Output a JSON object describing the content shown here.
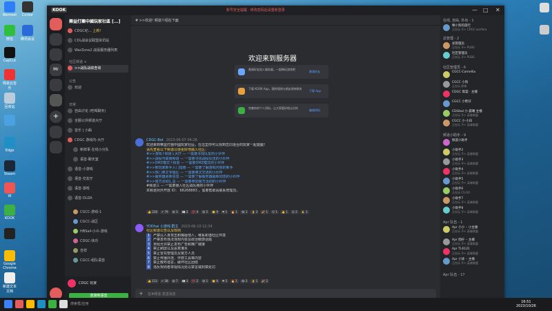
{
  "desktop": {
    "left_icons": [
      "Wemeet",
      "Cursor",
      "微信",
      "腾讯会议",
      "CapCut",
      "",
      "网易云音乐",
      "",
      "回收站",
      "",
      "Edge",
      "",
      "Steam",
      "",
      "W",
      "",
      "KOOK",
      "",
      "Google Chrome",
      "",
      "新建文本文档"
    ],
    "right_icons": [
      "",
      "",
      ""
    ]
  },
  "titlebar": {
    "logo": "KOOK",
    "notice": "账号安全提醒 · 修改密码后请重新登录",
    "win_min": "—",
    "win_max": "□",
    "win_close": "✕"
  },
  "servers": [
    "",
    "",
    "",
    "Mr",
    "",
    "",
    "",
    "",
    ""
  ],
  "channels": {
    "header": "樂益打團中國玩家社區 [...]",
    "pinned": [
      {
        "label": "CDGC纪…",
        "badge": "上新!"
      },
      {
        "label": "CDL战会议联盟资讯站"
      },
      {
        "label": "WarZone2 战役服务器列表"
      }
    ],
    "cat1": "社区频道 +",
    "items1": [
      {
        "label": ">>战队战绩查询"
      }
    ],
    "cat2": "公告",
    "items2": [
      {
        "label": "欢迎"
      }
    ],
    "cat3": "日常",
    "items3": [
      {
        "label": "自由讨论 (吃喝聊天)"
      },
      {
        "label": "全服公共频道大厅"
      },
      {
        "label": "音乐 | 小曲"
      },
      {
        "label": "CDGC 游戏内-大厅"
      },
      {
        "label": "新鲜事 在线小分队"
      },
      {
        "label": "语音-聊天室"
      },
      {
        "label": "语音-小游戏"
      },
      {
        "label": "语音-交友厅"
      },
      {
        "label": "语音-游戏"
      },
      {
        "label": "语音-OLDA"
      },
      {
        "label": "CGCC-游戏-1"
      },
      {
        "label": "CGCC-战区"
      },
      {
        "label": "HBSail-小众-游戏"
      },
      {
        "label": "CDGC-快乐"
      },
      {
        "label": "吉祥"
      },
      {
        "label": "CGCC-组队语音"
      }
    ],
    "user": {
      "name": "CDGC 玩家",
      "button": "连接到语音"
    }
  },
  "main": {
    "header": "# >>欢迎!  频道介绍在下面",
    "welcome": "欢迎来到服务器",
    "cards": [
      {
        "text": "邀请好友加入服务器，一起畅玩游戏吧",
        "action": "邀请好友"
      },
      {
        "text": "下载 KOOK App，随时随地与朋友保持联系",
        "action": "下载 App"
      },
      {
        "text": "完善你的个人资料，让大家更好地认识你",
        "action": "编辑资料"
      }
    ],
    "msg1": {
      "author": "CDGC-Bot",
      "time": "2023-06-07 04:28",
      "lines": [
        "欢迎来到樂益打團中國玩家社區，在這里你可以找到志同道合的玩家一起遊戲！",
        "请先查看以下频道以便更好地融入社区：",
        "#>>游戏↑频道↓大厅 — 一需要寻找队友的小伙伴",
        "#>>战役与联赛频道 — 一需要寻找战役队伍的小伙伴",
        "#>>DMZ模式↑频道 — 一需要DMZ模式的小伙伴",
        "#>>新玩家新手入门指南 — 一需要了解游戏内容的新手",
        "#>>热门英文专题区 — 一需要英文交流的小伙伴",
        "#>>服务器更新信息 — 一需要了解服务器最新动态的小伙伴",
        "#>>官方活动汇总 — 一需要参加官方活动的小伙伴",
        "#频道三 — 一需要接入社区战队赛的小伙伴",
        "本频道对外开放 ID：  68268883  ，需要帮助请联系管理员。"
      ],
      "reactions": [
        "👍 228",
        "✔ 79",
        "😀 3",
        "👀 2",
        "💯 4",
        "😁 5",
        "👏 9",
        "❤ 1",
        "🔥 1",
        "😂 1",
        "👌 3",
        "🎉 1",
        "😊 1",
        "👍 1",
        "😮 2",
        "🙏 1"
      ]
    },
    "msg2": {
      "author": "YDDhai 小游戏·群主",
      "time": "2023-06-10 12:34",
      "lines": [
        "社区频道公告以及规则",
        "严禁以人身攻击和侮辱他人，维系和谐社区环境",
        "严禁发布违法违规内容及政治敏感话题",
        "未经允许禁止发布广告和推广链接",
        "禁止刷屏以及恶意灌水",
        "禁止冒充管理员及官方人员",
        "禁止传播外挂、作弊工具等内容",
        "禁止散布谣言，破坏社区团结",
        "违反规则者将视情况处以禁言或封禁处罚"
      ],
      "reactions": [
        "👍 112",
        "✔ 38",
        "😀 7",
        "👀 3",
        "💯 2",
        "😁 1",
        "👏 6",
        "❤ 2",
        "🔥 1",
        "😂 3",
        "👌 1",
        "🎉 2"
      ]
    },
    "input_placeholder": "在#频道 发送消息"
  },
  "members": {
    "cat1": "在线, 自由, 外出 - 1",
    "cat2": "总管理 - 2",
    "cat3": "社区管理员 - 6",
    "cat4": "频道小助手 - 9",
    "cat5": "Apr 队伍 - 1",
    "cat6": "Apr 队伍 - 17",
    "list": [
      {
        "name": "樂小狗的旅行",
        "status": "正在玩 不+ CDGC-warfare"
      },
      {
        "name": "总管理员",
        "status": "正在玩 不+ PUBG"
      },
      {
        "name": "社区管理员",
        "status": "正在玩 不+ PUBG"
      },
      {
        "name": "CGCC-Camellia",
        "status": ""
      },
      {
        "name": "CGCC 小狗",
        "status": "正在玩 原神"
      },
      {
        "name": "CDGC 雨棠 · 主播",
        "status": ""
      },
      {
        "name": "CGCC 小熊仔",
        "status": ""
      },
      {
        "name": "CDGbal 小·晨曦 主播",
        "status": "正在玩 不+ 英雄联盟"
      },
      {
        "name": "CGCC 小·小白",
        "status": "正在玩 不+ 英雄联盟"
      },
      {
        "name": "频道小助手",
        "status": ""
      },
      {
        "name": "小助手2",
        "status": "正在玩 不+ 英雄联盟"
      },
      {
        "name": "小助手3",
        "status": "正在玩 不+ 英雄联盟"
      },
      {
        "name": "小助手4",
        "status": "正在玩 不+ 英雄联盟"
      },
      {
        "name": "小助手5",
        "status": "正在玩 不+ 英雄联盟"
      },
      {
        "name": "小助手6",
        "status": "正在玩 CS:GO"
      },
      {
        "name": "小助手7",
        "status": "正在玩 不+ 英雄联盟"
      },
      {
        "name": "小助手8",
        "status": "正在玩 不+ 英雄联盟"
      },
      {
        "name": "Apr 小小 ·· 小主播",
        "status": "正在玩 不+ 英雄联盟"
      },
      {
        "name": "Apr 雨柠 ·· 主播",
        "status": "正在玩 不+ 英雄联盟"
      },
      {
        "name": "Apr TL0121",
        "status": "正在玩 不+ 英雄联盟"
      },
      {
        "name": "Apr 小柒 ·· 主播",
        "status": "正在玩 不+ 英雄联盟"
      }
    ]
  },
  "taskbar": {
    "search": "搜索框/应用",
    "time": "16:51",
    "date": "2023/10/26"
  },
  "colors": {
    "accent": "#5aa9ff",
    "online": "#3cb043",
    "alert": "#e35d5d"
  }
}
